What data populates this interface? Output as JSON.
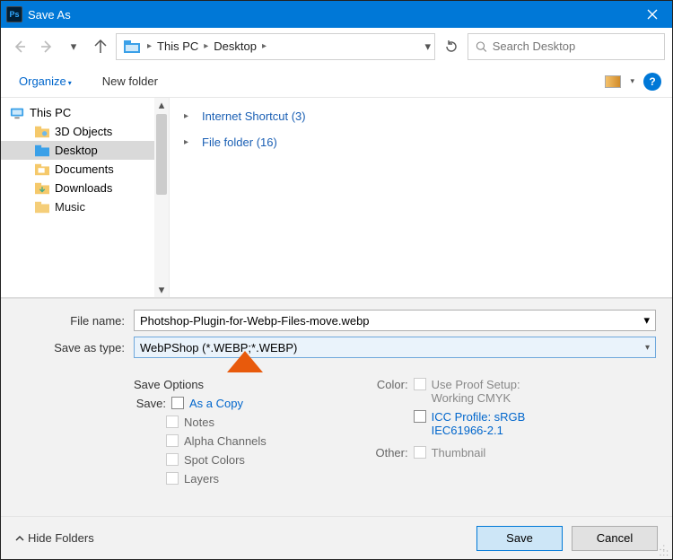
{
  "titlebar": {
    "app_icon_text": "Ps",
    "title": "Save As"
  },
  "nav": {
    "crumbs": [
      "This PC",
      "Desktop"
    ],
    "search_placeholder": "Search Desktop"
  },
  "toolbar": {
    "organize": "Organize",
    "newfolder": "New folder"
  },
  "tree": {
    "root": "This PC",
    "items": [
      {
        "label": "3D Objects"
      },
      {
        "label": "Desktop",
        "selected": true
      },
      {
        "label": "Documents"
      },
      {
        "label": "Downloads"
      },
      {
        "label": "Music"
      }
    ]
  },
  "content": {
    "groups": [
      {
        "label": "Internet Shortcut (3)"
      },
      {
        "label": "File folder (16)"
      }
    ]
  },
  "form": {
    "filename_label": "File name:",
    "filename_value": "Photshop-Plugin-for-Webp-Files-move.webp",
    "type_label": "Save as type:",
    "type_value": "WebPShop (*.WEBP;*.WEBP)"
  },
  "opts": {
    "heading": "Save Options",
    "save_label": "Save:",
    "as_copy": "As a Copy",
    "notes": "Notes",
    "alpha": "Alpha Channels",
    "spot": "Spot Colors",
    "layers": "Layers",
    "color_label": "Color:",
    "proof1": "Use Proof Setup:",
    "proof2": "Working CMYK",
    "icc1": "ICC Profile:  sRGB",
    "icc2": "IEC61966-2.1",
    "other_label": "Other:",
    "thumbnail": "Thumbnail"
  },
  "footer": {
    "hide": "Hide Folders",
    "save": "Save",
    "cancel": "Cancel"
  }
}
